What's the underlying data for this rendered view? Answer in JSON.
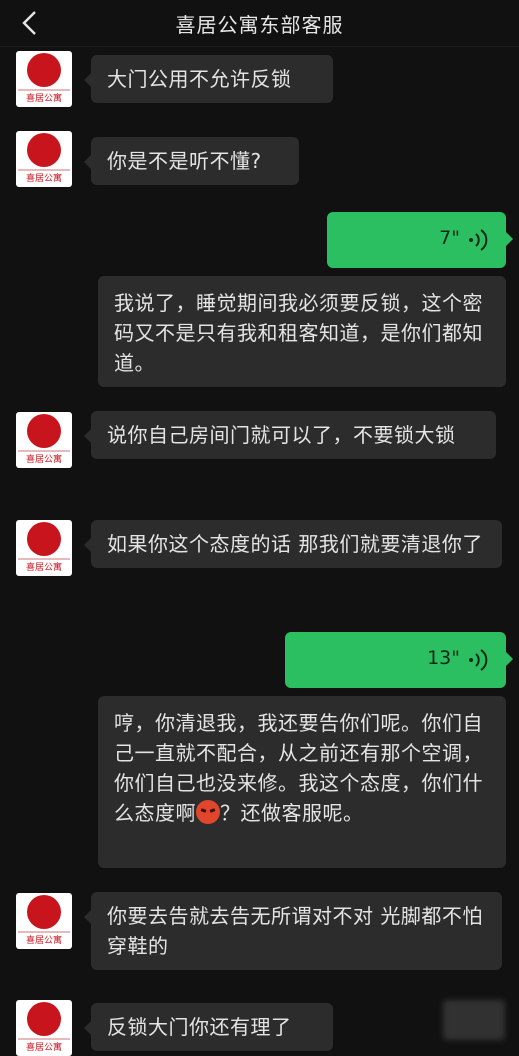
{
  "header": {
    "title": "喜居公寓东部客服",
    "back_icon": "chevron-left-icon"
  },
  "avatar": {
    "brand_text": "喜居公寓",
    "accent": "#c8141c"
  },
  "messages": [
    {
      "side": "left",
      "type": "text",
      "text": "大门公用不允许反锁"
    },
    {
      "side": "left",
      "type": "text",
      "text": "你是不是听不懂?"
    },
    {
      "side": "right",
      "type": "voice",
      "duration": "7\"",
      "transcript": "我说了，睡觉期间我必须要反锁，这个密码又不是只有我和租客知道，是你们都知道。"
    },
    {
      "side": "left",
      "type": "text",
      "text": "说你自己房间门就可以了，不要锁大锁"
    },
    {
      "side": "left",
      "type": "text",
      "text": "如果你这个态度的话 那我们就要清退你了"
    },
    {
      "side": "right",
      "type": "voice",
      "duration": "13\"",
      "transcript_part1": "哼，你清退我，我还要告你们呢。你们自己一直就不配合，从之前还有那个空调，你们自己也没来修。我这个态度，你们什么态度啊",
      "emoji": "angry-face-emoji",
      "transcript_part2": "？还做客服呢。"
    },
    {
      "side": "left",
      "type": "text",
      "text": "你要去告就去告无所谓对不对 光脚都不怕穿鞋的"
    },
    {
      "side": "left",
      "type": "text",
      "text": "反锁大门你还有理了"
    }
  ],
  "colors": {
    "background": "#111111",
    "bubble_gray": "#2c2c2c",
    "voice_green": "#2bbf62"
  }
}
